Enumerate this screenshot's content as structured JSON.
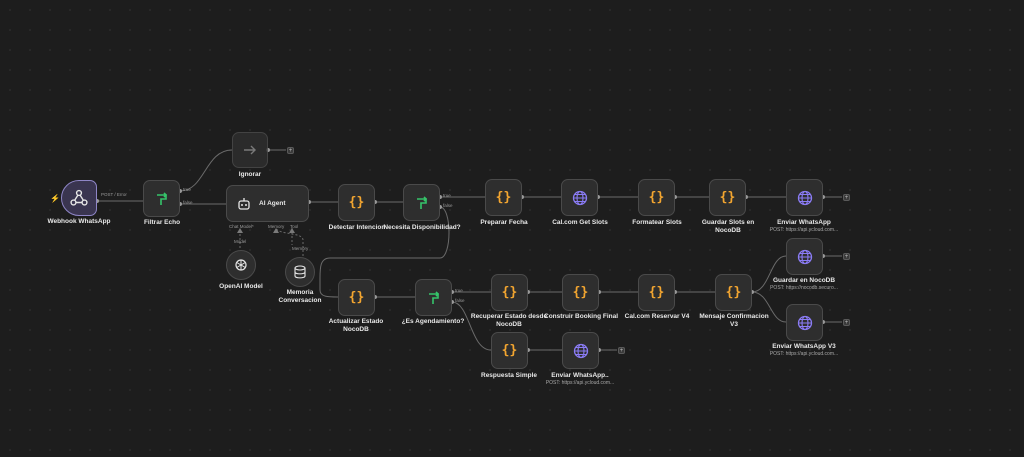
{
  "colors": {
    "canvas": "#1d1d1d",
    "node": "#2e2e2e",
    "edge": "#6b6b6b",
    "code": "#f4a630",
    "filter": "#35c46a",
    "http": "#8b7cf6",
    "trigger": "#8f86c7"
  },
  "nodes": {
    "webhook": {
      "label": "Webhook WhatsApp",
      "icon": "webhook-icon"
    },
    "filtrar": {
      "label": "Filtrar Echo",
      "icon": "filter-icon"
    },
    "ignorar": {
      "label": "Ignorar",
      "icon": "arrow-right-icon"
    },
    "agent": {
      "label": "AI Agent",
      "icon": "robot-icon",
      "ports": {
        "chat_model": "Chat Model*",
        "memory": "Memory",
        "tool": "Tool"
      }
    },
    "openai": {
      "label": "OpenAI Model",
      "icon": "openai-icon"
    },
    "memoria": {
      "label": "Memoria Conversacion",
      "icon": "database-icon"
    },
    "detectar": {
      "label": "Detectar Intencion",
      "icon": "code-icon"
    },
    "necesita": {
      "label": "Necesita Disponibilidad?",
      "icon": "filter-icon"
    },
    "preparar": {
      "label": "Preparar Fecha",
      "icon": "code-icon"
    },
    "calget": {
      "label": "Cal.com Get Slots",
      "icon": "globe-icon"
    },
    "formatear": {
      "label": "Formatear Slots",
      "icon": "code-icon"
    },
    "guardar_slots": {
      "label": "Guardar Slots en NocoDB",
      "icon": "code-icon"
    },
    "enviar1": {
      "label": "Enviar WhatsApp",
      "sub": "POST: https://api.ycloud.com...",
      "icon": "globe-icon"
    },
    "actualizar": {
      "label": "Actualizar Estado NocoDB",
      "icon": "code-icon"
    },
    "esagenda": {
      "label": "¿Es Agendamiento?",
      "icon": "filter-icon"
    },
    "recuperar": {
      "label": "Recuperar Estado desde NocoDB",
      "icon": "code-icon"
    },
    "construir": {
      "label": "Construir Booking Final",
      "icon": "code-icon"
    },
    "calreservar": {
      "label": "Cal.com Reservar V4",
      "icon": "code-icon"
    },
    "mensaje": {
      "label": "Mensaje Confirmacion V3",
      "icon": "code-icon"
    },
    "guardar_noco": {
      "label": "Guardar en NocoDB",
      "sub": "POST: https://nocodb.securo...",
      "icon": "globe-icon"
    },
    "enviar_v3": {
      "label": "Enviar WhatsApp V3",
      "sub": "POST: https://api.ycloud.com...",
      "icon": "globe-icon"
    },
    "respuesta": {
      "label": "Respuesta Simple",
      "icon": "code-icon"
    },
    "enviar2": {
      "label": "Enviar WhatsApp..",
      "sub": "POST: https://api.ycloud.com...",
      "icon": "globe-icon"
    }
  },
  "edge_labels": {
    "post_error": "POST / Error",
    "true1": "true",
    "false1": "false",
    "true2": "true",
    "false2": "false",
    "true3": "true",
    "false3": "false",
    "model": "Model",
    "memory": "Memory"
  },
  "plus": "+"
}
